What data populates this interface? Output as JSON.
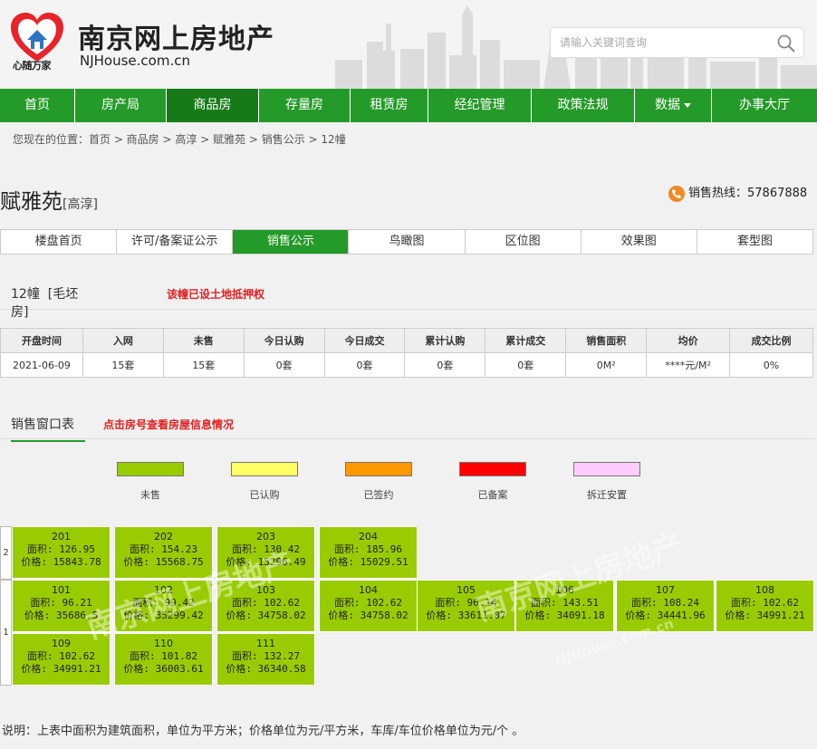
{
  "header": {
    "logo_caption": "心随万家",
    "site_name": "南京网上房地产",
    "site_domain": "NJHouse.com.cn",
    "search_placeholder": "请输入关键词查询"
  },
  "nav": [
    "首页",
    "房产局",
    "商品房",
    "存量房",
    "租赁房",
    "经纪管理",
    "政策法规",
    "数据",
    "办事大厅"
  ],
  "nav_active": "商品房",
  "breadcrumb": "您现在的位置：首页 > 商品房 > 高淳 > 赋雅苑 > 销售公示 > 12幢",
  "project": {
    "name": "赋雅苑",
    "district": "[高淳]",
    "hotline": "销售热线：57867888"
  },
  "subtabs": [
    "楼盘首页",
    "许可/备案证公示",
    "销售公示",
    "鸟瞰图",
    "区位图",
    "效果图",
    "套型图"
  ],
  "subtab_active": "销售公示",
  "building": {
    "name": "12幢",
    "type": "[毛坯房]",
    "note": "该幢已设土地抵押权"
  },
  "stats": {
    "headers": [
      "开盘时间",
      "入网",
      "未售",
      "今日认购",
      "今日成交",
      "累计认购",
      "累计成交",
      "销售面积",
      "均价",
      "成交比例"
    ],
    "values": [
      "2021-06-09",
      "15套",
      "15套",
      "0套",
      "0套",
      "0套",
      "0套",
      "0M²",
      "****元/M²",
      "0%"
    ]
  },
  "window": {
    "title": "销售窗口表",
    "note": "点击房号查看房屋信息情况"
  },
  "legend": [
    {
      "label": "未售",
      "color": "#99cc00"
    },
    {
      "label": "已认购",
      "color": "#ffff66"
    },
    {
      "label": "已签约",
      "color": "#ff9900"
    },
    {
      "label": "已备案",
      "color": "#ff0000"
    },
    {
      "label": "拆迁安置",
      "color": "#ffccff"
    }
  ],
  "floors": [
    {
      "floor": "2",
      "units": [
        {
          "no": "201",
          "area": "面积: 126.95",
          "price": "价格: 15843.78"
        },
        {
          "no": "202",
          "area": "面积: 154.23",
          "price": "价格: 15568.75"
        },
        {
          "no": "203",
          "area": "面积: 130.42",
          "price": "价格: 15296.49"
        },
        {
          "no": "204",
          "area": "面积: 185.96",
          "price": "价格: 15029.51"
        }
      ]
    },
    {
      "floor": "1",
      "units": [
        {
          "no": "101",
          "area": "面积: 96.21",
          "price": "价格: 35686.5"
        },
        {
          "no": "102",
          "area": "面积: 99.42",
          "price": "价格: 35299.42"
        },
        {
          "no": "103",
          "area": "面积: 102.62",
          "price": "价格: 34758.02"
        },
        {
          "no": "104",
          "area": "面积: 102.62",
          "price": "价格: 34758.02"
        },
        {
          "no": "105",
          "area": "面积: 96.14",
          "price": "价格: 33611.07"
        },
        {
          "no": "106",
          "area": "面积: 143.51",
          "price": "价格: 34091.18"
        },
        {
          "no": "107",
          "area": "面积: 108.24",
          "price": "价格: 34441.96"
        },
        {
          "no": "108",
          "area": "面积: 102.62",
          "price": "价格: 34991.21"
        },
        {
          "no": "109",
          "area": "面积: 102.62",
          "price": "价格: 34991.21"
        },
        {
          "no": "110",
          "area": "面积: 101.82",
          "price": "价格: 36003.61"
        },
        {
          "no": "111",
          "area": "面积: 132.27",
          "price": "价格: 36340.58"
        }
      ]
    }
  ],
  "watermark": {
    "text": "南京网上房地产",
    "domain": "NJHouse.com.cn"
  },
  "footnote": "说明：上表中面积为建筑面积，单位为平方米；价格单位为元/平方米，车库/车位价格单位为元/个 。"
}
